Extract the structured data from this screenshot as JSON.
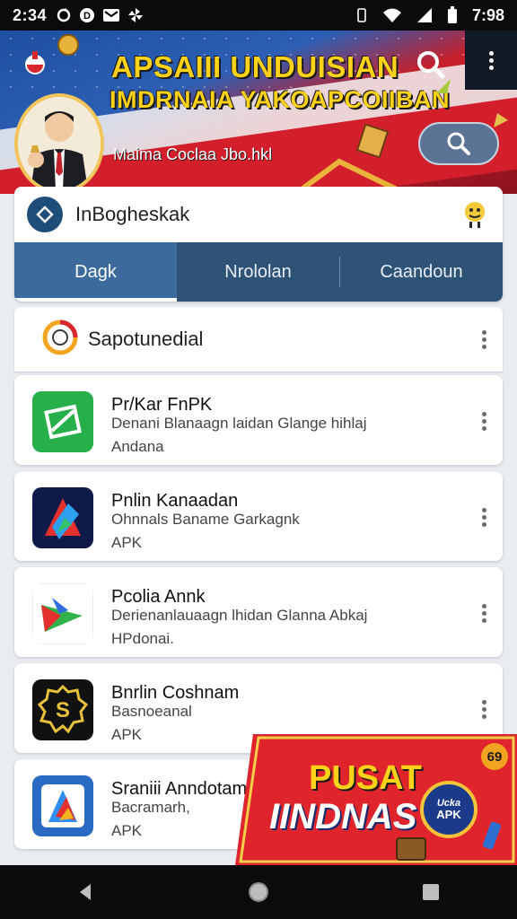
{
  "status_bar": {
    "time_left": "2:34",
    "time_right": "7:98",
    "icons": [
      "sync-icon",
      "circle-badge-icon",
      "mail-icon",
      "pinwheel-icon",
      "vibrate-icon",
      "wifi-icon",
      "signal-icon",
      "battery-icon"
    ]
  },
  "hero": {
    "title_line1": "APSAIII UNDUISIAN",
    "title_line2": "IMDRNAIA YAKOAPCOIIBAN",
    "subtitle": "Maima Coclaa Jbo.hkl",
    "colors": {
      "title": "#ffd21a",
      "blue": "#1e4fa0",
      "red": "#c81f2a"
    }
  },
  "search": {
    "query": "InBogheskak"
  },
  "tabs": [
    {
      "label": "Dagk",
      "active": true
    },
    {
      "label": "Nrololan",
      "active": false
    },
    {
      "label": "Caandoun",
      "active": false
    }
  ],
  "section": {
    "title": "Sapotunedial"
  },
  "apps": [
    {
      "name": "Pr/Kar FnPK",
      "desc": "Denani Blanaagn laidan Glange hihlaj",
      "meta": "Andana"
    },
    {
      "name": "Pnlin Kanaadan",
      "desc": "Ohnnals Baname Garkagnk",
      "meta": "APK"
    },
    {
      "name": "Pcolia Annk",
      "desc": "Derienanlauaagn lhidan Glanna Abkaj",
      "meta": "HPdonai."
    },
    {
      "name": "Bnrlin Coshnam",
      "desc": "Basnoeanal",
      "meta": "APK"
    },
    {
      "name": "Sraniii Anndotam",
      "desc": "Bacramarh,",
      "meta": "APK"
    }
  ],
  "promo": {
    "line1": "PUSAT",
    "line2": "IINDNAS",
    "badge": "APK",
    "badge_script": "Ucka",
    "corner": "69"
  }
}
